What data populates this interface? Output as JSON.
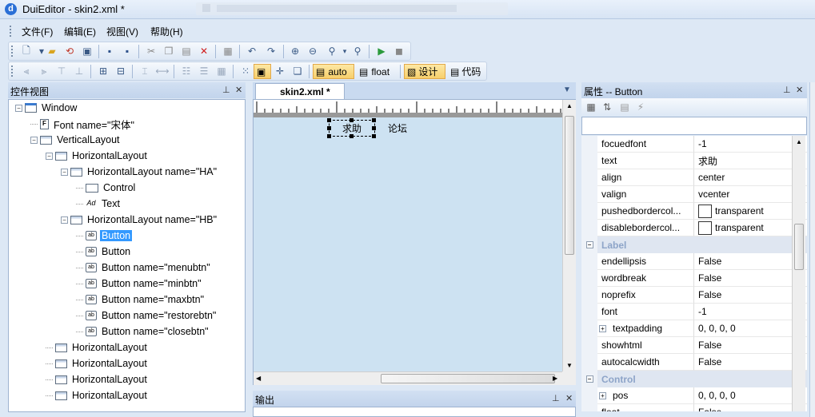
{
  "window": {
    "title": "DuiEditor - skin2.xml *"
  },
  "menu": [
    "文件(F)",
    "编辑(E)",
    "视图(V)",
    "帮助(H)"
  ],
  "toolbar": {
    "auto_label": "auto",
    "float_label": "float",
    "design_label": "设计",
    "code_label": "代码"
  },
  "control_view": {
    "title": "控件视图",
    "tree": [
      {
        "label": "Window",
        "icon": "window-icon",
        "level": 0
      },
      {
        "label": "Font name=\"宋体\"",
        "icon": "font-icon",
        "level": 1
      },
      {
        "label": "VerticalLayout",
        "icon": "layout-icon",
        "level": 1
      },
      {
        "label": "HorizontalLayout",
        "icon": "layout-icon",
        "level": 2
      },
      {
        "label": "HorizontalLayout name=\"HA\"",
        "icon": "layout-icon",
        "level": 3
      },
      {
        "label": "Control",
        "icon": "control-icon",
        "level": 4
      },
      {
        "label": "Text",
        "icon": "text-icon",
        "level": 4
      },
      {
        "label": "HorizontalLayout name=\"HB\"",
        "icon": "layout-icon",
        "level": 3
      },
      {
        "label": "Button",
        "icon": "button-icon",
        "level": 4,
        "selected": true
      },
      {
        "label": "Button",
        "icon": "button-icon",
        "level": 4
      },
      {
        "label": "Button name=\"menubtn\"",
        "icon": "button-icon",
        "level": 4
      },
      {
        "label": "Button name=\"minbtn\"",
        "icon": "button-icon",
        "level": 4
      },
      {
        "label": "Button name=\"maxbtn\"",
        "icon": "button-icon",
        "level": 4
      },
      {
        "label": "Button name=\"restorebtn\"",
        "icon": "button-icon",
        "level": 4
      },
      {
        "label": "Button name=\"closebtn\"",
        "icon": "button-icon",
        "level": 4
      },
      {
        "label": "HorizontalLayout",
        "icon": "layout-icon",
        "level": 2
      },
      {
        "label": "HorizontalLayout",
        "icon": "layout-icon",
        "level": 2
      },
      {
        "label": "HorizontalLayout",
        "icon": "layout-icon",
        "level": 2
      },
      {
        "label": "HorizontalLayout",
        "icon": "layout-icon",
        "level": 2
      }
    ]
  },
  "editor": {
    "tab_label": "skin2.xml *",
    "canvas_button_1": "求助",
    "canvas_button_2": "论坛"
  },
  "output": {
    "title": "输出"
  },
  "properties": {
    "title": "属性 -- Button",
    "rows": [
      {
        "name": "focuedfont",
        "value": "-1"
      },
      {
        "name": "text",
        "value": "求助"
      },
      {
        "name": "align",
        "value": "center"
      },
      {
        "name": "valign",
        "value": "vcenter"
      },
      {
        "name": "pushedbordercol...",
        "value": "transparent",
        "swatch": true
      },
      {
        "name": "disablebordercol...",
        "value": "transparent",
        "swatch": true
      },
      {
        "category": "Label"
      },
      {
        "name": "endellipsis",
        "value": "False"
      },
      {
        "name": "wordbreak",
        "value": "False"
      },
      {
        "name": "noprefix",
        "value": "False"
      },
      {
        "name": "font",
        "value": "-1"
      },
      {
        "name": "textpadding",
        "value": "0, 0, 0, 0",
        "expandable": true
      },
      {
        "name": "showhtml",
        "value": "False"
      },
      {
        "name": "autocalcwidth",
        "value": "False"
      },
      {
        "category": "Control"
      },
      {
        "name": "pos",
        "value": "0, 0, 0, 0",
        "expandable": true
      },
      {
        "name": "float",
        "value": "False"
      }
    ]
  }
}
